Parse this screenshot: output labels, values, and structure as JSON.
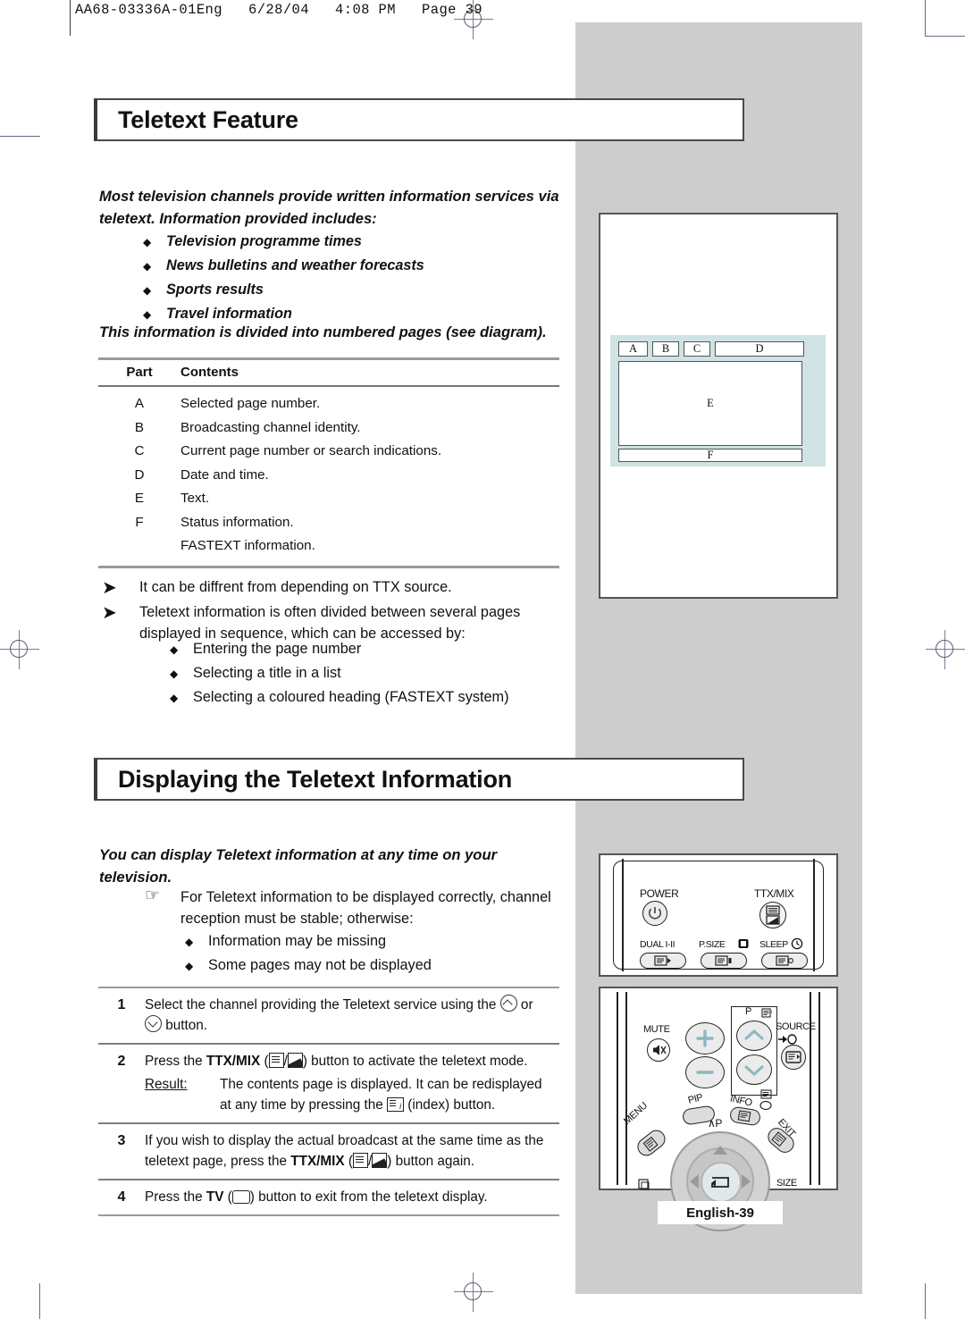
{
  "page_header": "AA68-03336A-01Eng   6/28/04   4:08 PM   Page 39",
  "footer": {
    "label": "English-39"
  },
  "sections": [
    {
      "title": "Teletext Feature",
      "lead": "Most television channels provide written information services via teletext. Information provided includes:",
      "bullets": [
        "Television programme times",
        "News bulletins and weather forecasts",
        "Sports results",
        "Travel information"
      ],
      "after_list": "This information is divided into numbered pages (see diagram)."
    },
    {
      "title": "Displaying the Teletext Information",
      "lead": "You can display Teletext information at any time on your television.",
      "hand_note": "For Teletext information to be displayed correctly, channel reception must be stable; otherwise:",
      "bullets": [
        "Information may be missing",
        "Some pages may not be displayed"
      ]
    }
  ],
  "table": {
    "headers": [
      "Part",
      "Contents"
    ],
    "rows": [
      {
        "part": "A",
        "contents": "Selected page number.",
        "contents2": ""
      },
      {
        "part": "B",
        "contents": "Broadcasting channel identity.",
        "contents2": ""
      },
      {
        "part": "C",
        "contents": "Current page number or search indications.",
        "contents2": ""
      },
      {
        "part": "D",
        "contents": "Date and time.",
        "contents2": ""
      },
      {
        "part": "E",
        "contents": "Text.",
        "contents2": ""
      },
      {
        "part": "F",
        "contents": "Status information.",
        "contents2": "FASTEXT information."
      }
    ]
  },
  "arrow_notes": [
    {
      "text": "It can be  diffrent from depending on TTX source."
    },
    {
      "text": "Teletext information is often divided between several pages displayed in sequence, which can be accessed by:"
    }
  ],
  "arrow_bullets": [
    "Entering the page number",
    "Selecting a title in a list",
    "Selecting a coloured heading (FASTEXT system)"
  ],
  "steps": [
    {
      "num": "1",
      "pre": "Select the channel providing the Teletext service using the ",
      "mid": " or ",
      "post": " button.",
      "result_label": "",
      "result_text": ""
    },
    {
      "num": "2",
      "pre": "Press the ",
      "bold": "TTX/MIX",
      "mid": " (",
      "sep": "/",
      "post": ") button to activate the teletext mode.",
      "result_label": "Result:",
      "result_text_a": "The contents page is displayed. It can be redisplayed",
      "result_text_b": "at any time by pressing the ",
      "result_text_c": " (index) button."
    },
    {
      "num": "3",
      "pre": "If you wish to display the actual broadcast at the same time as the teletext page, press the ",
      "bold": "TTX/MIX",
      "mid": " (",
      "sep": "/",
      "post": ") button again."
    },
    {
      "num": "4",
      "pre": "Press the ",
      "bold": "TV",
      "mid": " (",
      "post": ") button to exit from the teletext display."
    }
  ],
  "diagram": {
    "cells": [
      "A",
      "B",
      "C",
      "D"
    ],
    "screen": "E",
    "status": "F",
    "bg_color": "#cfe2e4"
  },
  "remote_top": {
    "labels": {
      "power": "POWER",
      "ttxmix": "TTX/MIX",
      "dual": "DUAL I-II",
      "psize": "P.SIZE",
      "sleep": "SLEEP"
    }
  },
  "remote_bottom": {
    "labels": {
      "mute": "MUTE",
      "p": "P",
      "source": "SOURCE",
      "pip": "PIP",
      "info": "INFO",
      "menu": "MENU",
      "exit": "EXIT",
      "chan_up": "∧P",
      "size": "SIZE",
      "plus": "+",
      "minus": "−"
    }
  },
  "colors": {
    "grey_panel": "#cdcdcd",
    "diagram_bg": "#cfe2e4",
    "rule": "#9a9a9a",
    "heading_border": "#4a4a4a"
  }
}
